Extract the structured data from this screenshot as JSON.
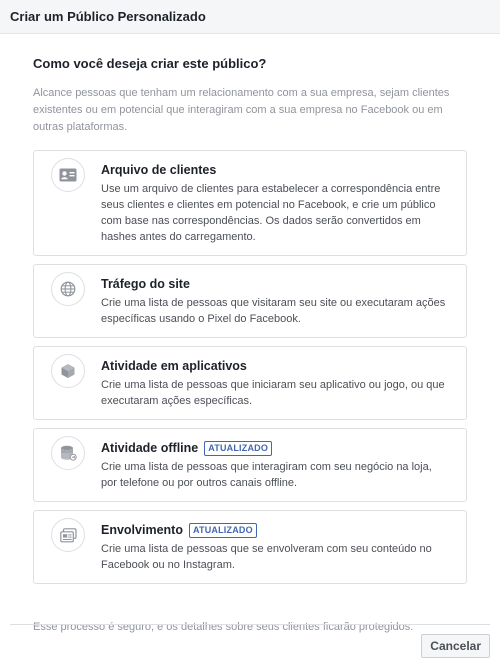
{
  "dialog": {
    "title": "Criar um Público Personalizado",
    "question": "Como você deseja criar este público?",
    "intro": "Alcance pessoas que tenham um relacionamento com a sua empresa, sejam clientes existentes ou em potencial que interagiram com a sua empresa no Facebook ou em outras plataformas.",
    "options": [
      {
        "title": "Arquivo de clientes",
        "icon": "contact-card-icon",
        "badge": "",
        "description": "Use um arquivo de clientes para estabelecer a correspondência entre seus clientes e clientes em potencial no Facebook, e crie um público com base nas correspondências. Os dados serão convertidos em hashes antes do carregamento."
      },
      {
        "title": "Tráfego do site",
        "icon": "globe-icon",
        "badge": "",
        "description": "Crie uma lista de pessoas que visitaram seu site ou executaram ações específicas usando o Pixel do Facebook."
      },
      {
        "title": "Atividade em aplicativos",
        "icon": "cube-icon",
        "badge": "",
        "description": "Crie uma lista de pessoas que iniciaram seu aplicativo ou jogo, ou que executaram ações específicas."
      },
      {
        "title": "Atividade offline",
        "icon": "offline-store-icon",
        "badge": "ATUALIZADO",
        "description": "Crie uma lista de pessoas que interagiram com seu negócio na loja, por telefone ou por outros canais offline."
      },
      {
        "title": "Envolvimento",
        "icon": "engagement-icon",
        "badge": "ATUALIZADO",
        "description": "Crie uma lista de pessoas que se envolveram com seu conteúdo no Facebook ou no Instagram."
      }
    ],
    "footer_note": "Esse processo é seguro, e os detalhes sobre seus clientes ficarão protegidos.",
    "cancel_label": "Cancelar"
  },
  "colors": {
    "badge": "#4267b2",
    "icon": "#90949c",
    "border": "#dddfe2",
    "muted_text": "#90949c"
  }
}
